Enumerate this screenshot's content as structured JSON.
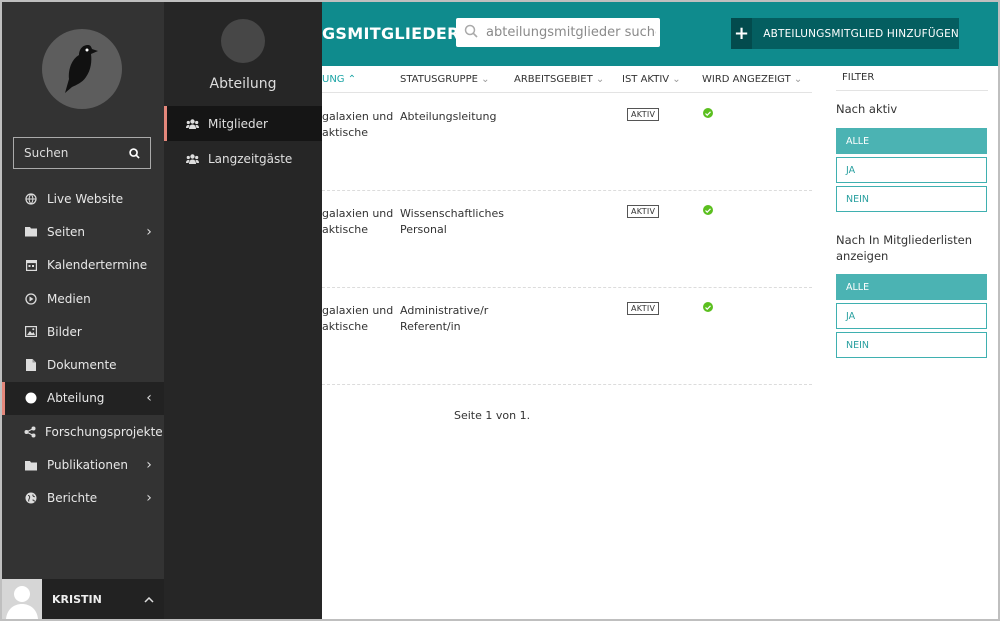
{
  "sidebar": {
    "search_placeholder": "Suchen",
    "items": [
      {
        "label": "Live Website",
        "icon": "globe-icon",
        "has_chevron": false
      },
      {
        "label": "Seiten",
        "icon": "folder-icon",
        "has_chevron": true
      },
      {
        "label": "Kalendertermine",
        "icon": "calendar-icon",
        "has_chevron": false
      },
      {
        "label": "Medien",
        "icon": "play-icon",
        "has_chevron": false
      },
      {
        "label": "Bilder",
        "icon": "image-icon",
        "has_chevron": false
      },
      {
        "label": "Dokumente",
        "icon": "document-icon",
        "has_chevron": false
      },
      {
        "label": "Abteilung",
        "icon": "circle-icon",
        "has_chevron": true
      },
      {
        "label": "Forschungsprojekte",
        "icon": "share-icon",
        "has_chevron": false
      },
      {
        "label": "Publikationen",
        "icon": "folder-icon",
        "has_chevron": true
      },
      {
        "label": "Berichte",
        "icon": "globe-icon",
        "has_chevron": true
      }
    ],
    "user": {
      "name": "KRISTIN"
    }
  },
  "submenu": {
    "title": "Abteilung",
    "items": [
      {
        "label": "Mitglieder",
        "icon": "users-icon"
      },
      {
        "label": "Langzeitgäste",
        "icon": "users-icon"
      }
    ]
  },
  "header": {
    "title": "GSMITGLIEDER",
    "search_placeholder": "abteilungsmitglieder suche",
    "add_button_label": "ABTEILUNGSMITGLIED HINZUFÜGEN"
  },
  "table": {
    "columns": [
      "UNG",
      "STATUSGRUPPE",
      "ARBEITSGEBIET",
      "IST AKTIV",
      "WIRD ANGEZEIGT"
    ],
    "rows": [
      {
        "abteilung_line1": "galaxien und",
        "abteilung_line2": "aktische",
        "status_line1": "Abteilungsleitung",
        "status_line2": "",
        "active_badge": "AKTIV"
      },
      {
        "abteilung_line1": "galaxien und",
        "abteilung_line2": "aktische",
        "status_line1": "Wissenschaftliches",
        "status_line2": "Personal",
        "active_badge": "AKTIV"
      },
      {
        "abteilung_line1": "galaxien und",
        "abteilung_line2": "aktische",
        "status_line1": "Administrative/r",
        "status_line2": "Referent/in",
        "active_badge": "AKTIV"
      }
    ],
    "pager": "Seite 1 von 1."
  },
  "filter": {
    "heading": "FILTER",
    "groups": [
      {
        "label": "Nach aktiv",
        "options": [
          "ALLE",
          "JA",
          "NEIN"
        ],
        "selected": "ALLE"
      },
      {
        "label": "Nach In Mitgliederlisten anzeigen",
        "options": [
          "ALLE",
          "JA",
          "NEIN"
        ],
        "selected": "ALLE"
      }
    ]
  },
  "colors": {
    "header": "#0f8b8d",
    "accent": "#e4877b",
    "filter_selected": "#4bb3b3",
    "check": "#5bbf1f"
  }
}
